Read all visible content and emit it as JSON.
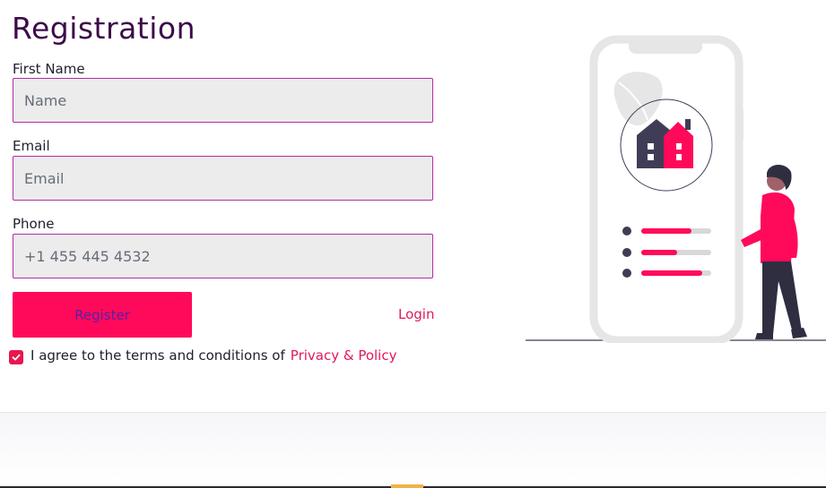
{
  "page": {
    "title": "Registration"
  },
  "form": {
    "first_name": {
      "label": "First Name",
      "placeholder": "Name",
      "value": ""
    },
    "email": {
      "label": "Email",
      "placeholder": "Email",
      "value": ""
    },
    "phone": {
      "label": "Phone",
      "placeholder": "+1 455 445 4532",
      "value": ""
    },
    "register_label": "Register",
    "login_label": "Login",
    "agree_text": "I agree to the terms and conditions of",
    "policy_label": "Privacy & Policy",
    "agree_checked": true
  },
  "colors": {
    "accent": "#ff0a5a",
    "title": "#3d0a4a",
    "field_border": "#b52aa8",
    "field_bg": "#ececec",
    "illustration_dark": "#3f3d56"
  },
  "icons": {
    "checkbox": "check-icon",
    "illustration": "house-on-phone-illustration"
  }
}
